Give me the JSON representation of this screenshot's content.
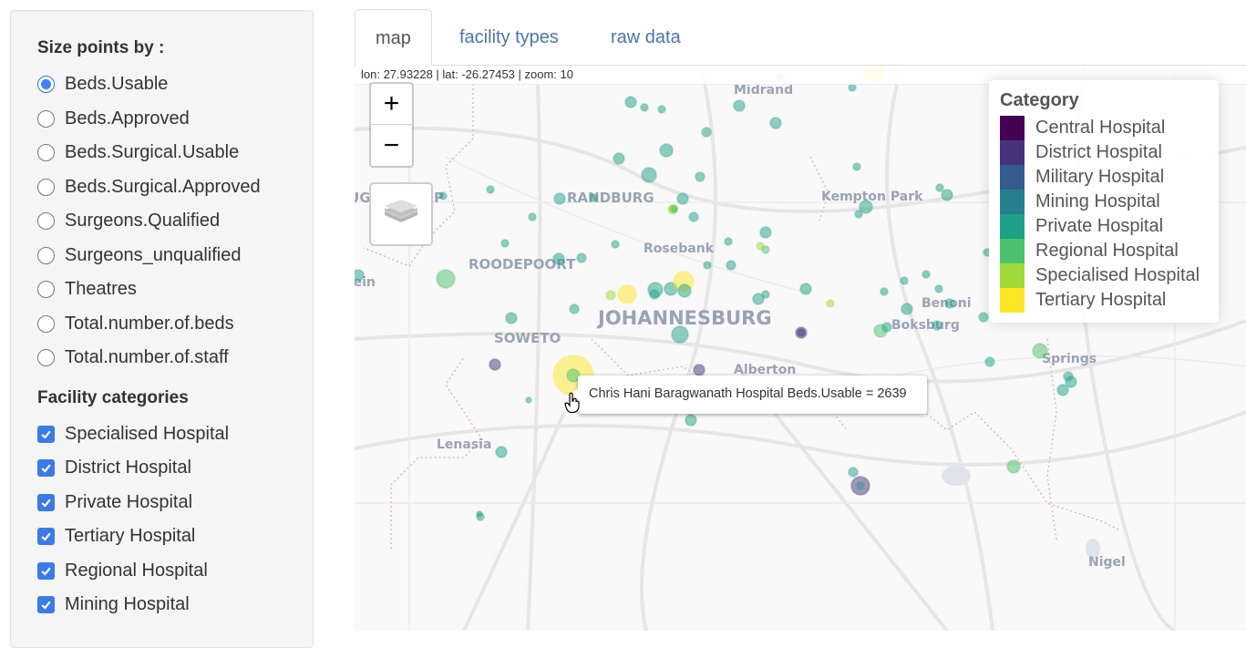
{
  "sidebar": {
    "size_title": "Size points by :",
    "size_options": [
      {
        "label": "Beds.Usable",
        "checked": true
      },
      {
        "label": "Beds.Approved",
        "checked": false
      },
      {
        "label": "Beds.Surgical.Usable",
        "checked": false
      },
      {
        "label": "Beds.Surgical.Approved",
        "checked": false
      },
      {
        "label": "Surgeons.Qualified",
        "checked": false
      },
      {
        "label": "Surgeons_unqualified",
        "checked": false
      },
      {
        "label": "Theatres",
        "checked": false
      },
      {
        "label": "Total.number.of.beds",
        "checked": false
      },
      {
        "label": "Total.number.of.staff",
        "checked": false
      }
    ],
    "categories_title": "Facility categories",
    "category_options": [
      {
        "label": "Specialised Hospital",
        "checked": true
      },
      {
        "label": "District Hospital",
        "checked": true
      },
      {
        "label": "Private Hospital",
        "checked": true
      },
      {
        "label": "Tertiary Hospital",
        "checked": true
      },
      {
        "label": "Regional Hospital",
        "checked": true
      },
      {
        "label": "Mining Hospital",
        "checked": true
      }
    ]
  },
  "tabs": [
    {
      "label": "map",
      "active": true
    },
    {
      "label": "facility types",
      "active": false
    },
    {
      "label": "raw data",
      "active": false
    }
  ],
  "map": {
    "coords_readout": "lon: 27.93228 | lat: -26.27453 | zoom: 10",
    "zoom_in_label": "+",
    "zoom_out_label": "−",
    "layers_icon": "layers-icon",
    "legend": {
      "title": "Category",
      "items": [
        {
          "label": "Central Hospital",
          "color": "#440154"
        },
        {
          "label": "District Hospital",
          "color": "#46337e"
        },
        {
          "label": "Military Hospital",
          "color": "#365c8d"
        },
        {
          "label": "Mining Hospital",
          "color": "#277f8e"
        },
        {
          "label": "Private Hospital",
          "color": "#1fa187"
        },
        {
          "label": "Regional Hospital",
          "color": "#4ac16d"
        },
        {
          "label": "Specialised Hospital",
          "color": "#a0da39"
        },
        {
          "label": "Tertiary Hospital",
          "color": "#fde725"
        }
      ]
    },
    "tooltip": "Chris Hani Baragwanath Hospital Beds.Usable = 2639",
    "place_labels": [
      {
        "name": "Midrand"
      },
      {
        "name": "RANDBURG"
      },
      {
        "name": "Kempton Park"
      },
      {
        "name": "Rosebank"
      },
      {
        "name": "ROODEPOORT"
      },
      {
        "name": "JOHANNESBURG"
      },
      {
        "name": "SOWETO"
      },
      {
        "name": "Benoni"
      },
      {
        "name": "Boksburg"
      },
      {
        "name": "Springs"
      },
      {
        "name": "Alberton"
      },
      {
        "name": "Lenasia"
      },
      {
        "name": "Nigel"
      },
      {
        "name": "KRUGERSDORP"
      },
      {
        "name": "Randfontein"
      }
    ]
  }
}
